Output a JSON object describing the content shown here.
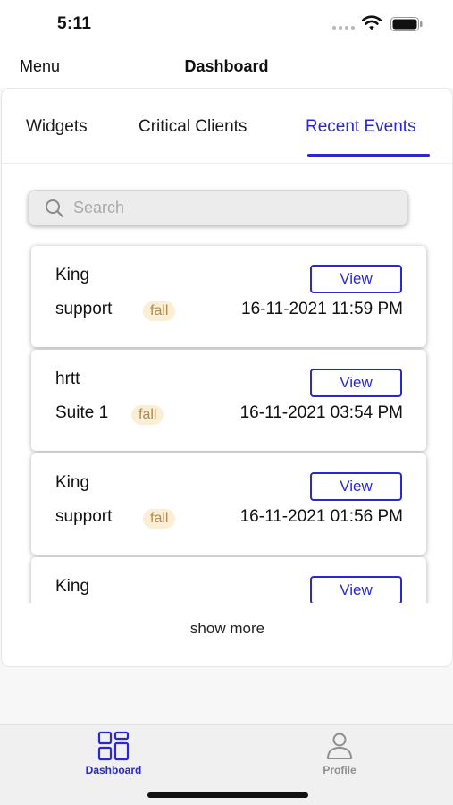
{
  "status_bar": {
    "time": "5:11",
    "icons": [
      "signal-dots-icon",
      "wifi-icon",
      "battery-icon"
    ]
  },
  "nav": {
    "menu_label": "Menu",
    "title": "Dashboard"
  },
  "tabs": [
    {
      "label": "Widgets",
      "active": false
    },
    {
      "label": "Critical Clients",
      "active": false
    },
    {
      "label": "Recent Events",
      "active": true
    }
  ],
  "search": {
    "placeholder": "Search",
    "value": ""
  },
  "events": [
    {
      "name": "King",
      "location": "support",
      "badge": "fall",
      "datetime": "16-11-2021 11:59 PM",
      "action_label": "View"
    },
    {
      "name": "hrtt",
      "location": "Suite 1",
      "badge": "fall",
      "datetime": "16-11-2021 03:54 PM",
      "action_label": "View"
    },
    {
      "name": "King",
      "location": "support",
      "badge": "fall",
      "datetime": "16-11-2021 01:56 PM",
      "action_label": "View"
    },
    {
      "name": "King",
      "location": "",
      "badge": "",
      "datetime": "",
      "action_label": "View"
    }
  ],
  "show_more_label": "show more",
  "tab_bar": {
    "items": [
      {
        "label": "Dashboard",
        "icon": "dashboard-icon",
        "active": true
      },
      {
        "label": "Profile",
        "icon": "profile-icon",
        "active": false
      }
    ]
  },
  "colors": {
    "accent": "#2a28cf",
    "badge_bg": "#fbeed6",
    "badge_text": "#b08a46",
    "inactive": "#8e8e8e"
  }
}
